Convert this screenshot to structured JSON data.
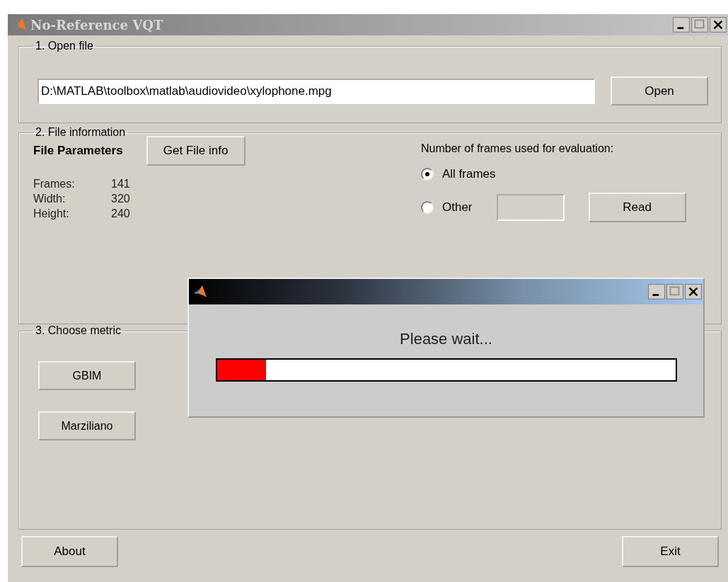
{
  "window": {
    "title": "No-Reference VQT"
  },
  "open_file": {
    "legend": "1. Open file",
    "path": "D:\\MATLAB\\toolbox\\matlab\\audiovideo\\xylophone.mpg",
    "button": "Open"
  },
  "file_information": {
    "legend": "2. File information",
    "heading": "File Parameters",
    "get_button": "Get File info",
    "params": [
      {
        "label": "Frames:",
        "value": "141"
      },
      {
        "label": "Width:",
        "value": "320"
      },
      {
        "label": "Height:",
        "value": "240"
      }
    ],
    "frames_prompt": "Number of frames used for evaluation:",
    "options": [
      {
        "label": "All frames",
        "selected": true
      },
      {
        "label": "Other",
        "selected": false
      }
    ],
    "read_button": "Read"
  },
  "choose_metric": {
    "legend": "3. Choose metric",
    "buttons": [
      "GBIM",
      "Marziliano"
    ]
  },
  "buttons": [
    "About",
    "Exit"
  ],
  "progress_dialog": {
    "message": "Please wait...",
    "level": 0.107
  }
}
